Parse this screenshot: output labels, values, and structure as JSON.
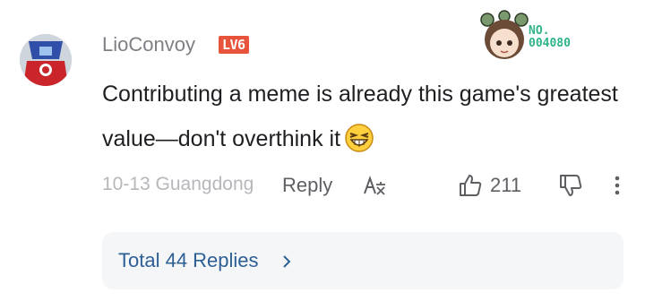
{
  "comment": {
    "username": "LioConvoy",
    "level": "LV6",
    "medal_number": "NO. 004080",
    "text": "Contributing a meme is already this game's greatest value—don't overthink it",
    "emoji_icon": "laughing-emoji-icon",
    "date_location": "10-13 Guangdong",
    "reply_label": "Reply",
    "like_count": "211"
  },
  "replies": {
    "label": "Total 44 Replies"
  },
  "colors": {
    "level_badge": "#e8543b",
    "medal_text": "#2fb38a",
    "replies_link": "#2d5f95",
    "replies_bg": "#f4f6f8"
  }
}
